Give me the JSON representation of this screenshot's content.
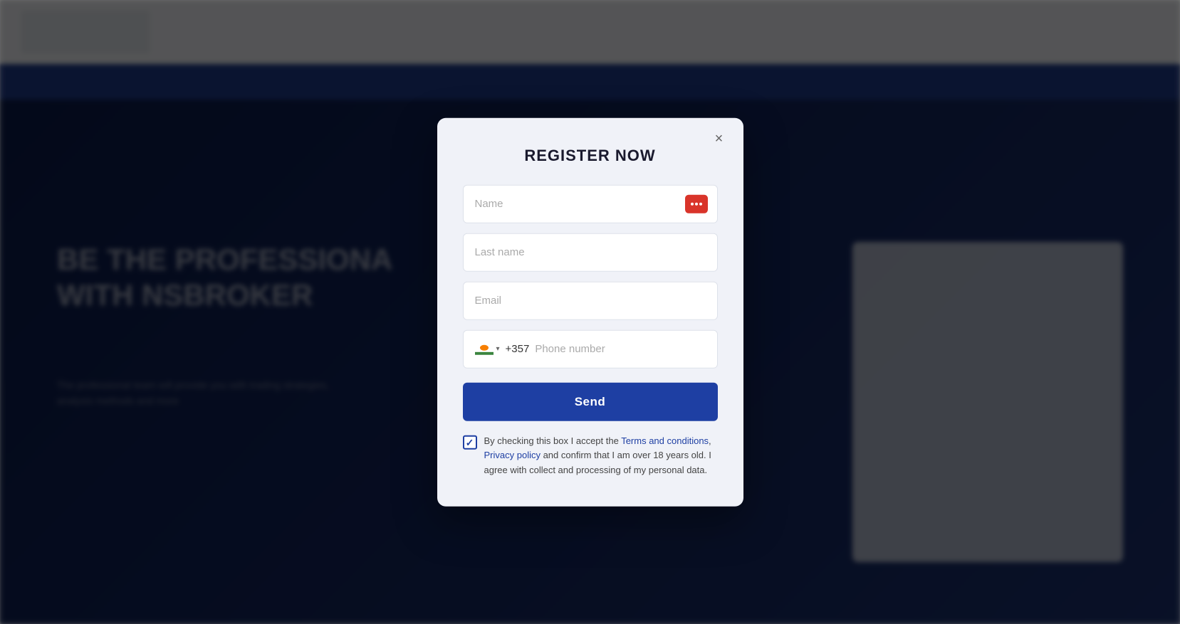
{
  "background": {
    "hero_text_line1": "BE THE PROFESSIONA",
    "hero_text_line2": "WITH NSBROKER",
    "hero_sub": "The professional team will provide you with trading strategies, analysis methods and more"
  },
  "modal": {
    "title": "REGISTER NOW",
    "close_label": "×",
    "fields": {
      "name_placeholder": "Name",
      "lastname_placeholder": "Last name",
      "email_placeholder": "Email",
      "phone_code": "+357",
      "phone_placeholder": "Phone number"
    },
    "send_button": "Send",
    "terms_text_before": "By checking this box I accept the ",
    "terms_link1": "Terms and conditions",
    "terms_comma": ", ",
    "terms_link2": "Privacy policy",
    "terms_text_after": " and confirm that I am over 18 years old. I agree with collect and processing of my personal data."
  }
}
